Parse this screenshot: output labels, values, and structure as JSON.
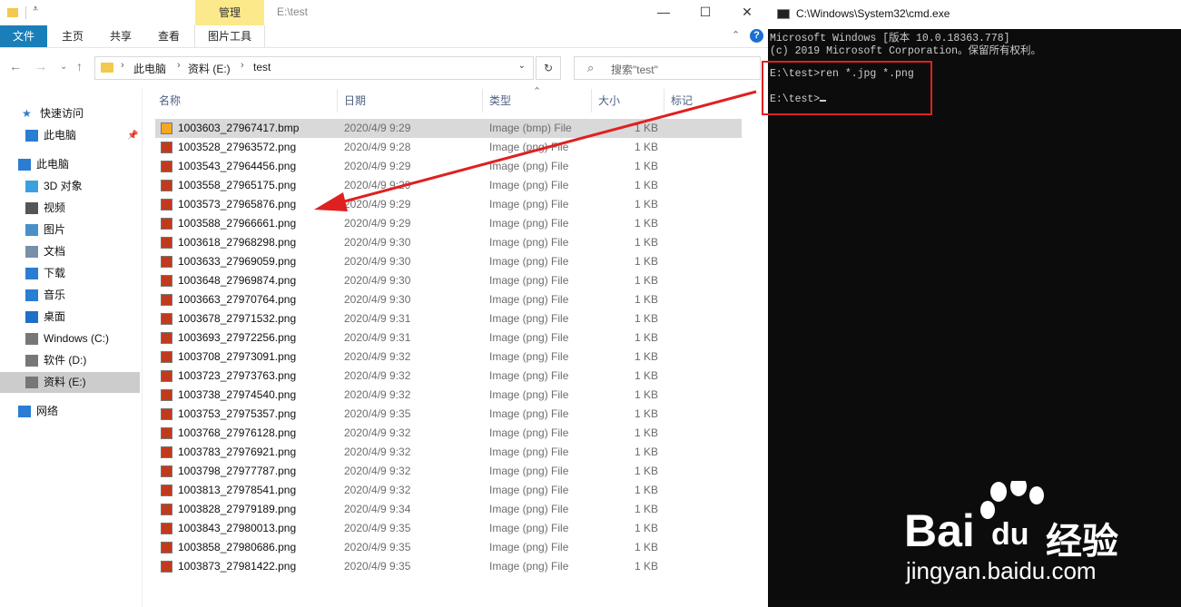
{
  "explorer": {
    "title": "E:\\test",
    "manage_tab": "管理",
    "window_buttons": {
      "minimize": "—",
      "maximize": "☐",
      "close": "✕"
    },
    "ribbon_tabs": [
      {
        "label": "文件"
      },
      {
        "label": "主页"
      },
      {
        "label": "共享"
      },
      {
        "label": "查看"
      },
      {
        "label": "图片工具"
      }
    ],
    "address": {
      "crumbs": [
        "此电脑",
        "资料 (E:)",
        "test"
      ]
    },
    "search": {
      "placeholder": "搜索\"test\""
    },
    "nav_items": [
      {
        "label": "快速访问",
        "icon": "star-icon",
        "color": "#2b7cd3",
        "pinned": false
      },
      {
        "label": "此电脑",
        "icon": "computer-icon",
        "color": "#2b7cd3",
        "pinned": true
      },
      {
        "label": "此电脑",
        "icon": "computer-icon",
        "color": "#2b7cd3",
        "pinned": false
      },
      {
        "label": "3D 对象",
        "icon": "cube-icon",
        "color": "#3aa0e0",
        "pinned": false
      },
      {
        "label": "视频",
        "icon": "film-icon",
        "color": "#555555",
        "pinned": false
      },
      {
        "label": "图片",
        "icon": "picture-icon",
        "color": "#4a90c8",
        "pinned": false
      },
      {
        "label": "文档",
        "icon": "document-icon",
        "color": "#7a8ea8",
        "pinned": false
      },
      {
        "label": "下载",
        "icon": "download-icon",
        "color": "#2b7cd3",
        "pinned": false
      },
      {
        "label": "音乐",
        "icon": "music-icon",
        "color": "#2b7cd3",
        "pinned": false
      },
      {
        "label": "桌面",
        "icon": "desktop-icon",
        "color": "#1e6fc7",
        "pinned": false
      },
      {
        "label": "Windows (C:)",
        "icon": "drive-icon",
        "color": "#777777",
        "pinned": false
      },
      {
        "label": "软件 (D:)",
        "icon": "drive-icon",
        "color": "#777777",
        "pinned": false
      },
      {
        "label": "资料 (E:)",
        "icon": "drive-icon",
        "color": "#777777",
        "pinned": false,
        "selected": true
      },
      {
        "label": "网络",
        "icon": "network-icon",
        "color": "#2b7cd3",
        "pinned": false
      }
    ],
    "columns": {
      "name": "名称",
      "date": "日期",
      "type": "类型",
      "size": "大小",
      "tags": "标记"
    },
    "files": [
      {
        "name": "1003603_27967417.bmp",
        "date": "2020/4/9 9:29",
        "type": "Image (bmp) File",
        "size": "1 KB",
        "selected": true
      },
      {
        "name": "1003528_27963572.png",
        "date": "2020/4/9 9:28",
        "type": "Image (png) File",
        "size": "1 KB"
      },
      {
        "name": "1003543_27964456.png",
        "date": "2020/4/9 9:29",
        "type": "Image (png) File",
        "size": "1 KB"
      },
      {
        "name": "1003558_27965175.png",
        "date": "2020/4/9 9:29",
        "type": "Image (png) File",
        "size": "1 KB"
      },
      {
        "name": "1003573_27965876.png",
        "date": "2020/4/9 9:29",
        "type": "Image (png) File",
        "size": "1 KB"
      },
      {
        "name": "1003588_27966661.png",
        "date": "2020/4/9 9:29",
        "type": "Image (png) File",
        "size": "1 KB"
      },
      {
        "name": "1003618_27968298.png",
        "date": "2020/4/9 9:30",
        "type": "Image (png) File",
        "size": "1 KB"
      },
      {
        "name": "1003633_27969059.png",
        "date": "2020/4/9 9:30",
        "type": "Image (png) File",
        "size": "1 KB"
      },
      {
        "name": "1003648_27969874.png",
        "date": "2020/4/9 9:30",
        "type": "Image (png) File",
        "size": "1 KB"
      },
      {
        "name": "1003663_27970764.png",
        "date": "2020/4/9 9:30",
        "type": "Image (png) File",
        "size": "1 KB"
      },
      {
        "name": "1003678_27971532.png",
        "date": "2020/4/9 9:31",
        "type": "Image (png) File",
        "size": "1 KB"
      },
      {
        "name": "1003693_27972256.png",
        "date": "2020/4/9 9:31",
        "type": "Image (png) File",
        "size": "1 KB"
      },
      {
        "name": "1003708_27973091.png",
        "date": "2020/4/9 9:32",
        "type": "Image (png) File",
        "size": "1 KB"
      },
      {
        "name": "1003723_27973763.png",
        "date": "2020/4/9 9:32",
        "type": "Image (png) File",
        "size": "1 KB"
      },
      {
        "name": "1003738_27974540.png",
        "date": "2020/4/9 9:32",
        "type": "Image (png) File",
        "size": "1 KB"
      },
      {
        "name": "1003753_27975357.png",
        "date": "2020/4/9 9:35",
        "type": "Image (png) File",
        "size": "1 KB"
      },
      {
        "name": "1003768_27976128.png",
        "date": "2020/4/9 9:32",
        "type": "Image (png) File",
        "size": "1 KB"
      },
      {
        "name": "1003783_27976921.png",
        "date": "2020/4/9 9:32",
        "type": "Image (png) File",
        "size": "1 KB"
      },
      {
        "name": "1003798_27977787.png",
        "date": "2020/4/9 9:32",
        "type": "Image (png) File",
        "size": "1 KB"
      },
      {
        "name": "1003813_27978541.png",
        "date": "2020/4/9 9:32",
        "type": "Image (png) File",
        "size": "1 KB"
      },
      {
        "name": "1003828_27979189.png",
        "date": "2020/4/9 9:34",
        "type": "Image (png) File",
        "size": "1 KB"
      },
      {
        "name": "1003843_27980013.png",
        "date": "2020/4/9 9:35",
        "type": "Image (png) File",
        "size": "1 KB"
      },
      {
        "name": "1003858_27980686.png",
        "date": "2020/4/9 9:35",
        "type": "Image (png) File",
        "size": "1 KB"
      },
      {
        "name": "1003873_27981422.png",
        "date": "2020/4/9 9:35",
        "type": "Image (png) File",
        "size": "1 KB"
      }
    ]
  },
  "cmd": {
    "title": "C:\\Windows\\System32\\cmd.exe",
    "lines": [
      "Microsoft Windows [版本 10.0.18363.778]",
      "(c) 2019 Microsoft Corporation。保留所有权利。",
      "",
      "E:\\test>ren *.jpg *.png",
      "",
      "E:\\test>"
    ]
  },
  "annotation": {
    "color": "#e02020"
  },
  "watermark": {
    "brand": "Bai",
    "brand2": "经验",
    "url": "jingyan.baidu.com"
  },
  "colors": {
    "ribbon_file": "#1a7fb8",
    "manage_tab": "#fce98b",
    "selection": "#d9d9d9"
  }
}
